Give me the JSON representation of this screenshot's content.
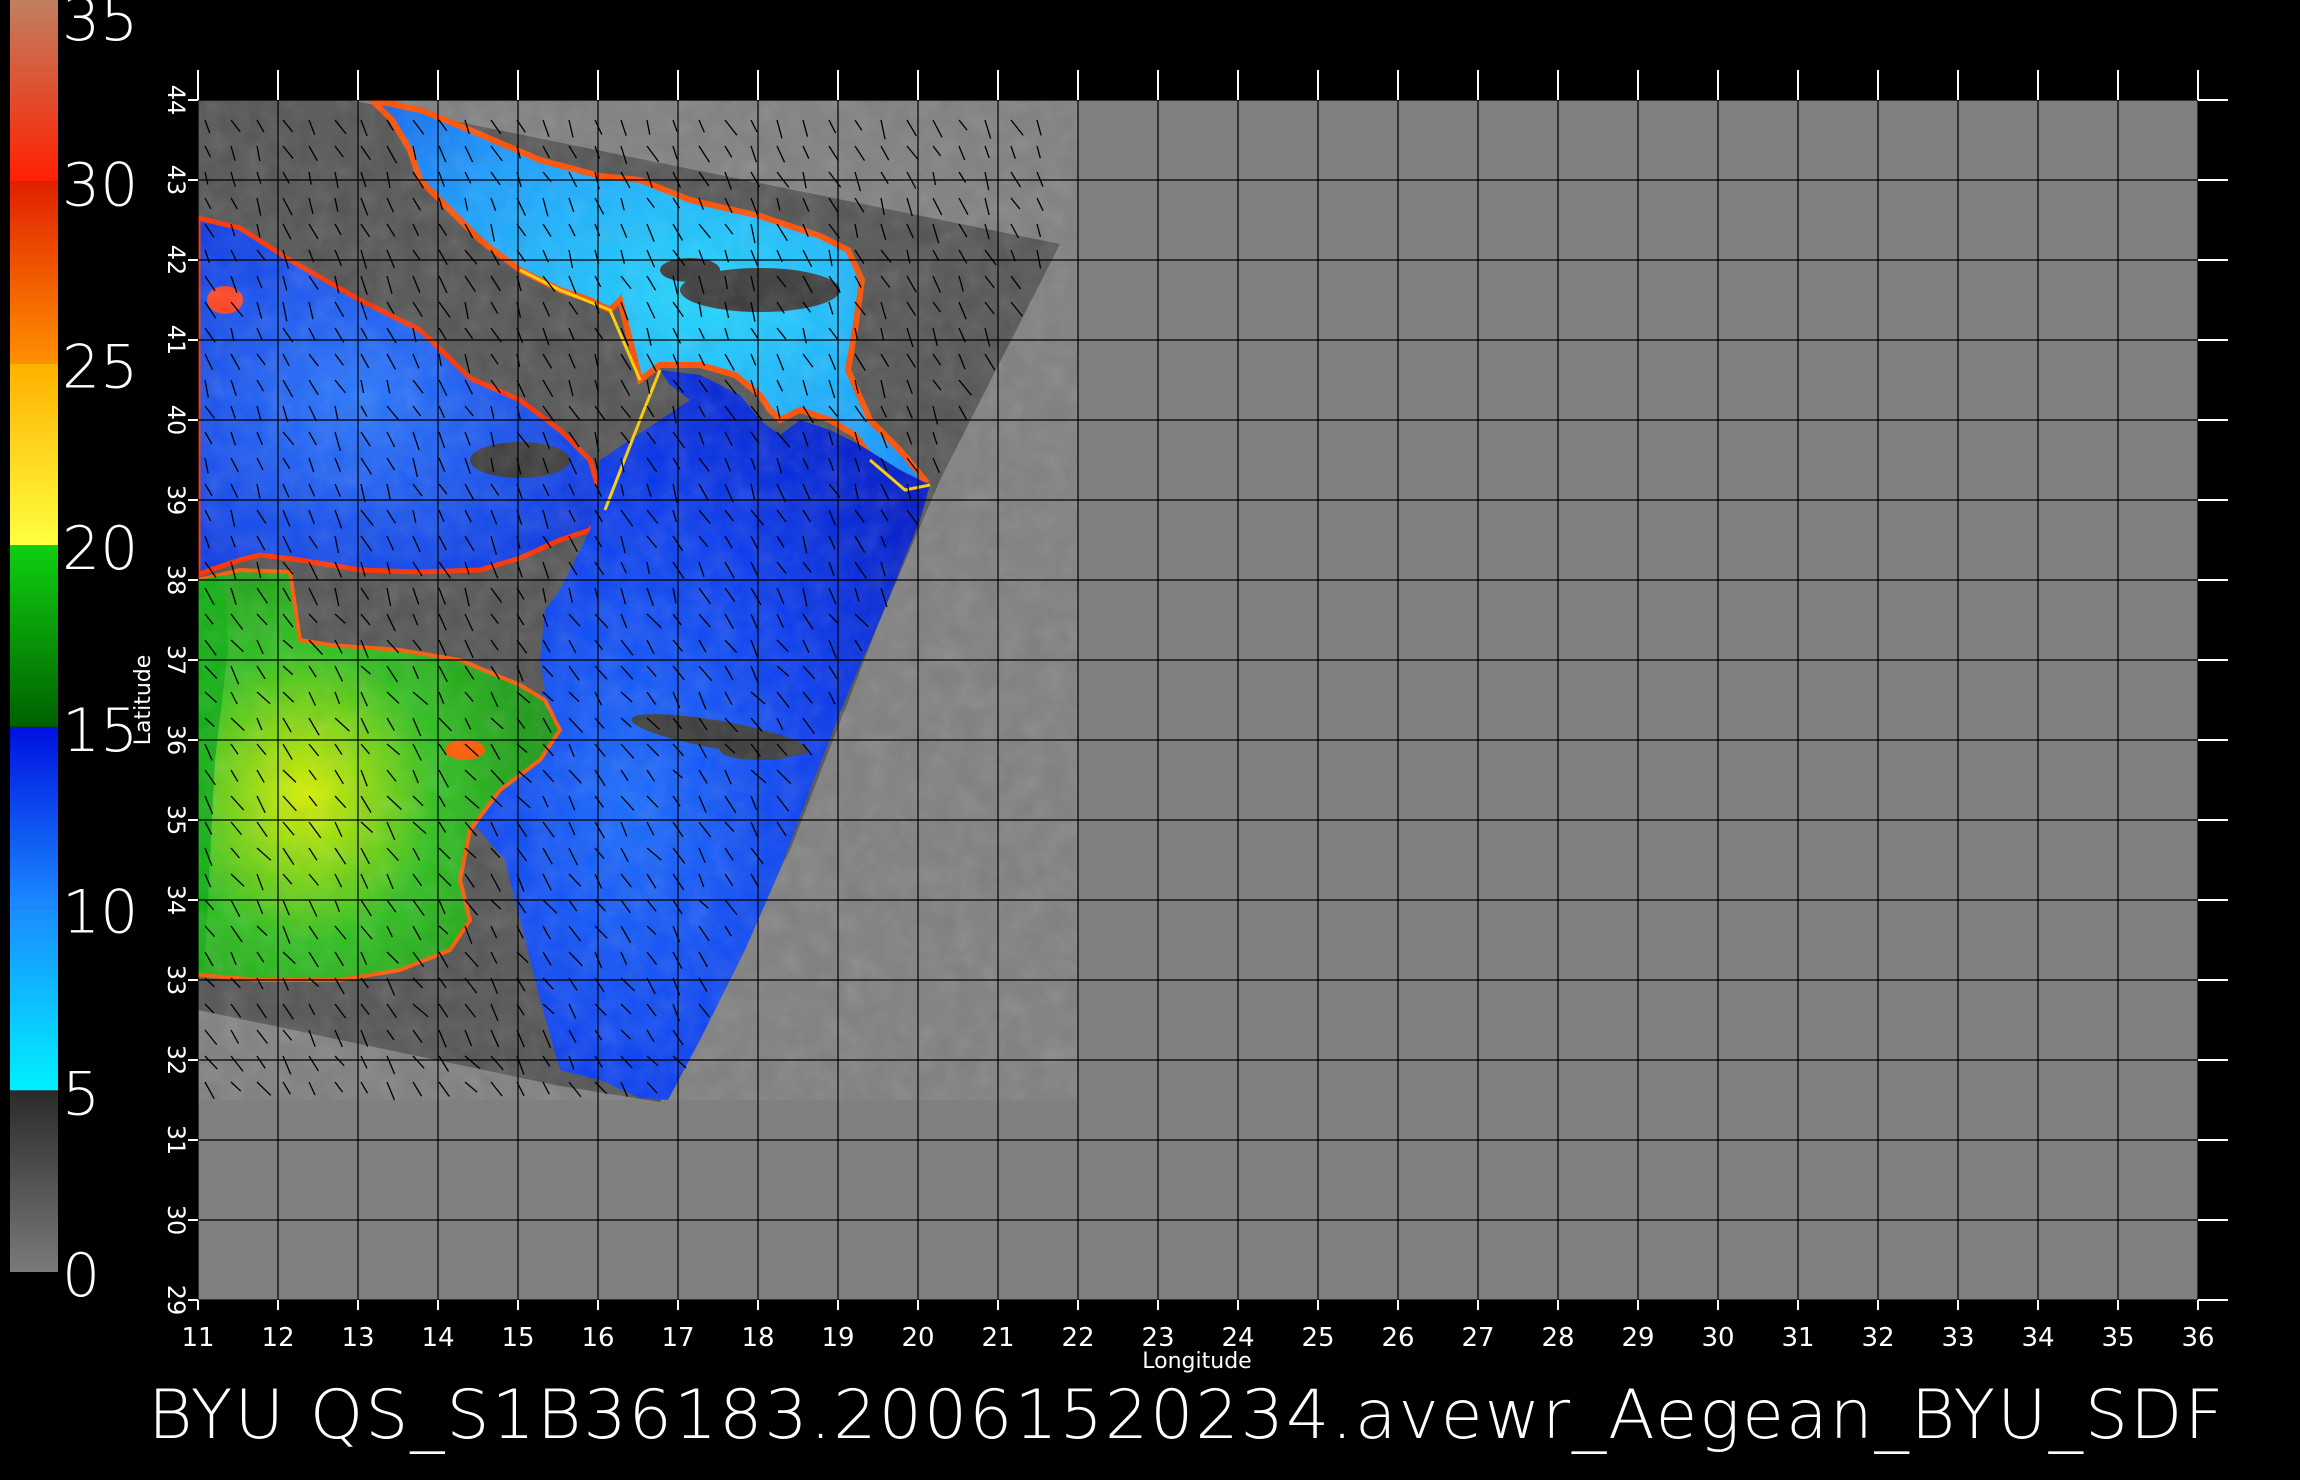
{
  "map": {
    "x_axis_label": "Longitude",
    "y_axis_label": "Latitude",
    "x_ticks": [
      11,
      12,
      13,
      14,
      15,
      16,
      17,
      18,
      19,
      20,
      21,
      22,
      23,
      24,
      25,
      26,
      27,
      28,
      29,
      30,
      31,
      32,
      33,
      34,
      35,
      36
    ],
    "y_ticks": [
      29,
      30,
      31,
      32,
      33,
      34,
      35,
      36,
      37,
      38,
      39,
      40,
      41,
      42,
      43,
      44
    ],
    "lon_range": [
      11,
      36
    ],
    "lat_range": [
      29,
      44
    ],
    "background_color": "#808080",
    "no_data_swath_color": "#555555",
    "grid_color": "#000000"
  },
  "color_scale": {
    "labels": [
      "35",
      "30",
      "25",
      "20",
      "15",
      "10",
      "5",
      "0"
    ],
    "segments": [
      {
        "from": 0,
        "to": 5,
        "colors": [
          "#7a7a7a",
          "#2a2a2a"
        ]
      },
      {
        "from": 5,
        "to": 10,
        "colors": [
          "#00f0ff",
          "#1a8cff"
        ]
      },
      {
        "from": 10,
        "to": 15,
        "colors": [
          "#1a8cff",
          "#0010e0"
        ]
      },
      {
        "from": 15,
        "to": 20,
        "colors": [
          "#006000",
          "#10d010"
        ]
      },
      {
        "from": 20,
        "to": 25,
        "colors": [
          "#ffff40",
          "#ffb000"
        ]
      },
      {
        "from": 25,
        "to": 30,
        "colors": [
          "#ff9000",
          "#e02000"
        ]
      },
      {
        "from": 30,
        "to": 35,
        "colors": [
          "#ff2000",
          "#c08060"
        ]
      }
    ]
  },
  "footer": {
    "title": "BYU  QS_S1B36183.20061520234.avewr_Aegean_BYU_SDF"
  }
}
